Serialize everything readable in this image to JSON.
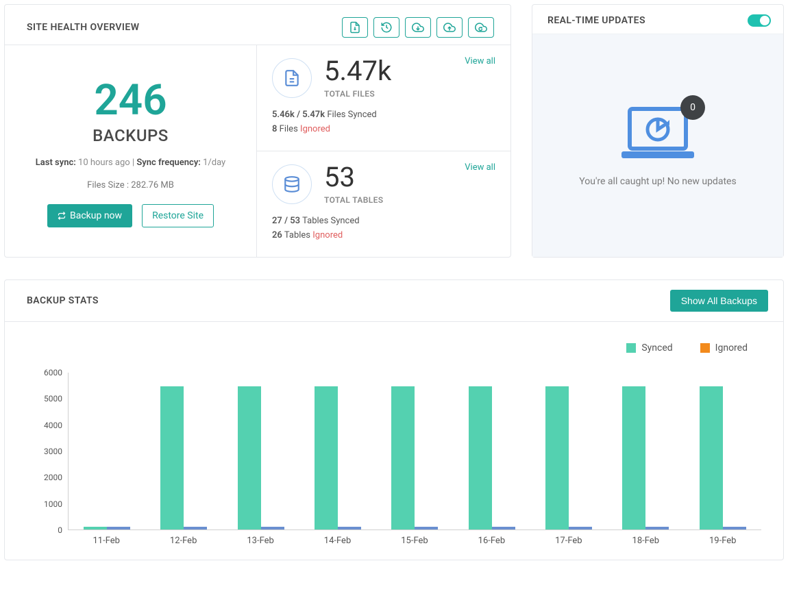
{
  "site_health": {
    "title": "SITE HEALTH OVERVIEW",
    "backups_count": "246",
    "backups_label": "BACKUPS",
    "last_sync_label": "Last sync:",
    "last_sync_value": "10 hours ago",
    "sync_freq_label": "Sync frequency:",
    "sync_freq_value": "1/day",
    "files_size": "Files Size : 282.76 MB",
    "backup_now_label": "Backup now",
    "restore_label": "Restore Site",
    "files": {
      "view_all": "View all",
      "value": "5.47k",
      "label": "TOTAL FILES",
      "synced_count": "5.46k / 5.47k",
      "synced_suffix": "Files Synced",
      "ignored_count": "8",
      "ignored_mid": "Files",
      "ignored_word": "Ignored"
    },
    "tables": {
      "view_all": "View all",
      "value": "53",
      "label": "TOTAL TABLES",
      "synced_count": "27 / 53",
      "synced_suffix": "Tables Synced",
      "ignored_count": "26",
      "ignored_mid": "Tables",
      "ignored_word": "Ignored"
    }
  },
  "realtime": {
    "title": "REAL-TIME UPDATES",
    "badge": "0",
    "caught_up": "You're all caught up! No new updates"
  },
  "backup_stats": {
    "title": "BACKUP STATS",
    "show_all": "Show All Backups",
    "legend_synced": "Synced",
    "legend_ignored": "Ignored"
  },
  "chart_data": {
    "type": "bar",
    "categories": [
      "11-Feb",
      "12-Feb",
      "13-Feb",
      "14-Feb",
      "15-Feb",
      "16-Feb",
      "17-Feb",
      "18-Feb",
      "19-Feb"
    ],
    "series": [
      {
        "name": "Synced",
        "color": "#54d1b0",
        "values": [
          100,
          5470,
          5470,
          5470,
          5470,
          5470,
          5470,
          5470,
          5470
        ]
      },
      {
        "name": "Ignored",
        "color": "#6a8fd0",
        "values": [
          100,
          100,
          100,
          100,
          100,
          100,
          100,
          100,
          100
        ]
      }
    ],
    "ylim": [
      0,
      6000
    ],
    "yticks": [
      0,
      1000,
      2000,
      3000,
      4000,
      5000,
      6000
    ],
    "xlabel": "",
    "ylabel": ""
  }
}
